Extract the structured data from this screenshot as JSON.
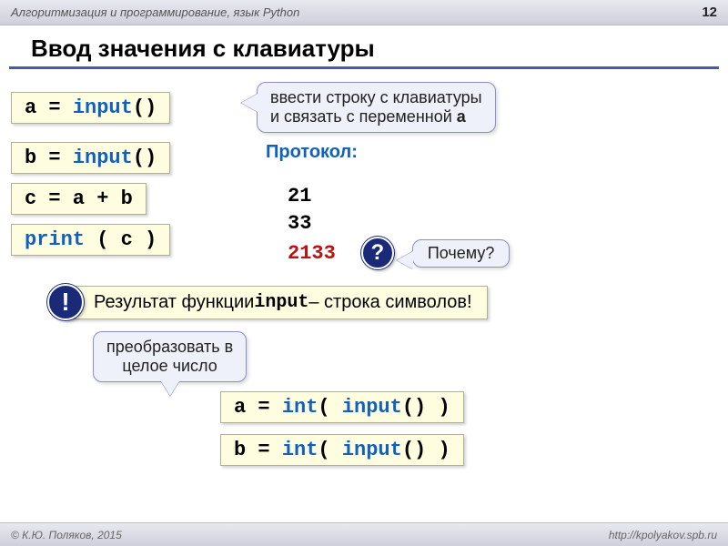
{
  "header": {
    "subject": "Алгоритмизация и программирование, язык Python",
    "page": "12"
  },
  "title": "Ввод значения с клавиатуры",
  "code": {
    "line1_a": "a = ",
    "line1_b": "input",
    "line1_c": "()",
    "line2_a": "b = ",
    "line2_b": "input",
    "line2_c": "()",
    "line3": "c = a + b",
    "line4_a": "print",
    "line4_b": " ( c )",
    "line5_a": "a = ",
    "line5_b": "int",
    "line5_c": "( ",
    "line5_d": "input",
    "line5_e": "() )",
    "line6_a": "b = ",
    "line6_b": "int",
    "line6_c": "( ",
    "line6_d": "input",
    "line6_e": "() )"
  },
  "callouts": {
    "c1_line1": "ввести строку с клавиатуры",
    "c1_line2_a": "и связать с переменной ",
    "c1_line2_b": "a",
    "why": "Почему?",
    "convert_line1": "преобразовать в",
    "convert_line2": "целое число"
  },
  "protocol": {
    "label": "Протокол:",
    "v1": "21",
    "v2": "33",
    "v3": "2133"
  },
  "badges": {
    "q": "?",
    "excl": "!"
  },
  "result": {
    "t1": "Результат функции ",
    "t2": "input",
    "t3": " – строка символов!"
  },
  "footer": {
    "left": "© К.Ю. Поляков, 2015",
    "right": "http://kpolyakov.spb.ru"
  }
}
